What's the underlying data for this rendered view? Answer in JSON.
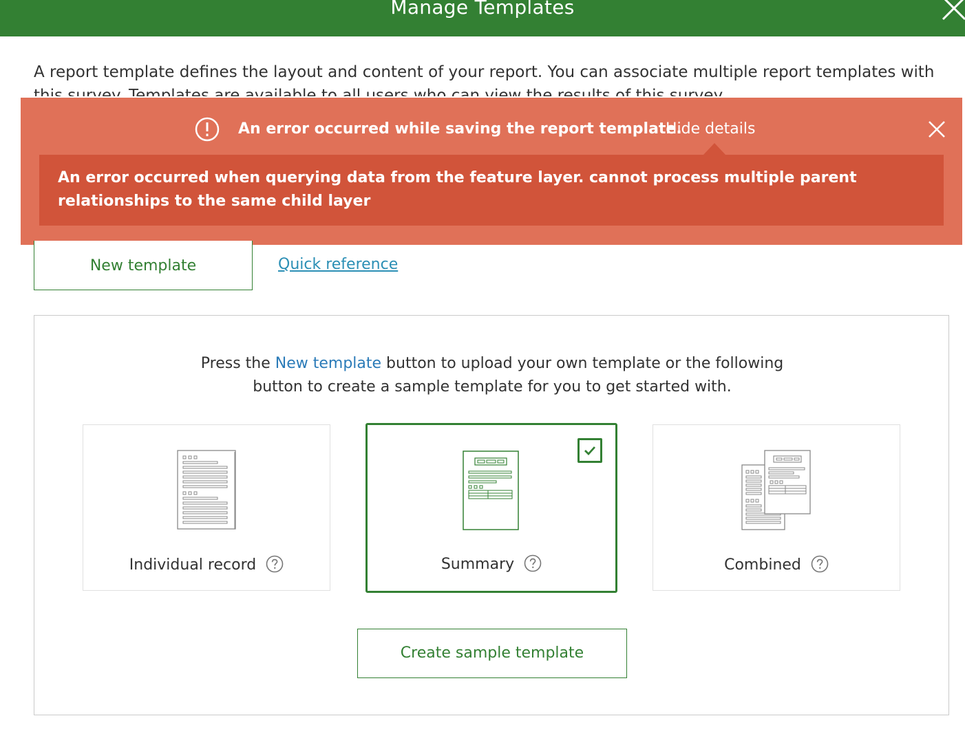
{
  "header": {
    "title": "Manage Templates"
  },
  "intro": {
    "text": "A report template defines the layout and content of your report. You can associate multiple report templates with this survey. Templates are available to all users who can view the results of this survey."
  },
  "error_banner": {
    "message": "An error occurred while saving the report template.",
    "toggle_label": "Hide details",
    "details": "An error occurred when querying data from the feature layer. cannot process multiple parent relationships to the same child layer",
    "icon": "exclamation-circle-icon",
    "background_color": "#e07158",
    "details_color": "#d1543a"
  },
  "actions": {
    "new_template_label": "New template",
    "quick_reference_label": "Quick reference"
  },
  "panel": {
    "text_before": "Press the ",
    "text_link": "New template",
    "text_after_line1": " button to upload your own template or the following",
    "text_line2": "button to create a sample template for you to get started with.",
    "cards": [
      {
        "label": "Individual record",
        "selected": false,
        "icon": "individual-record-document-icon"
      },
      {
        "label": "Summary",
        "selected": true,
        "icon": "summary-document-icon"
      },
      {
        "label": "Combined",
        "selected": false,
        "icon": "combined-documents-icon"
      }
    ],
    "create_button_label": "Create sample template"
  },
  "colors": {
    "brand_green": "#338033",
    "link_blue": "#2b8fb5"
  }
}
